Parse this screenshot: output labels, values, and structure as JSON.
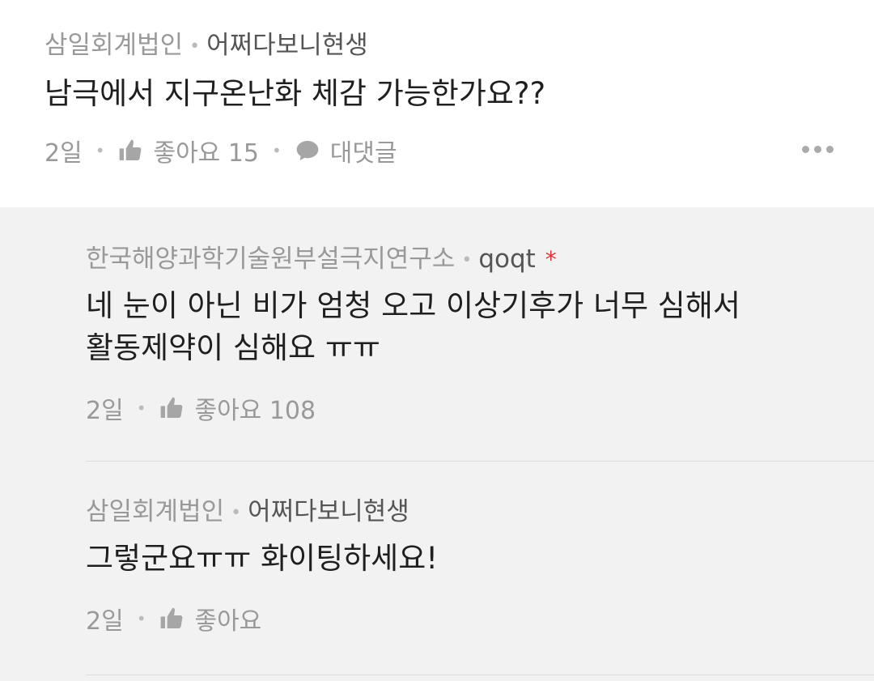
{
  "comment": {
    "company": "삼일회계법인",
    "nickname": "어쩌다보니현생",
    "text": "남극에서 지구온난화 체감 가능한가요??",
    "time": "2일",
    "like_label": "좋아요 15",
    "reply_label": "대댓글"
  },
  "replies": [
    {
      "company": "한국해양과학기술원부설극지연구소",
      "nickname": "qoqt",
      "badge": "*",
      "text_line1": "네 눈이 아닌 비가 엄청 오고 이상기후가 너무 심해서",
      "text_line2": "활동제약이 심해요 ㅠㅠ",
      "time": "2일",
      "like_label": "좋아요 108"
    },
    {
      "company": "삼일회계법인",
      "nickname": "어쩌다보니현생",
      "text": "그렇군요ㅠㅠ 화이팅하세요!",
      "time": "2일",
      "like_label": "좋아요"
    }
  ],
  "colors": {
    "badge": "#e0323c",
    "reply_background": "#f2f2f2"
  }
}
